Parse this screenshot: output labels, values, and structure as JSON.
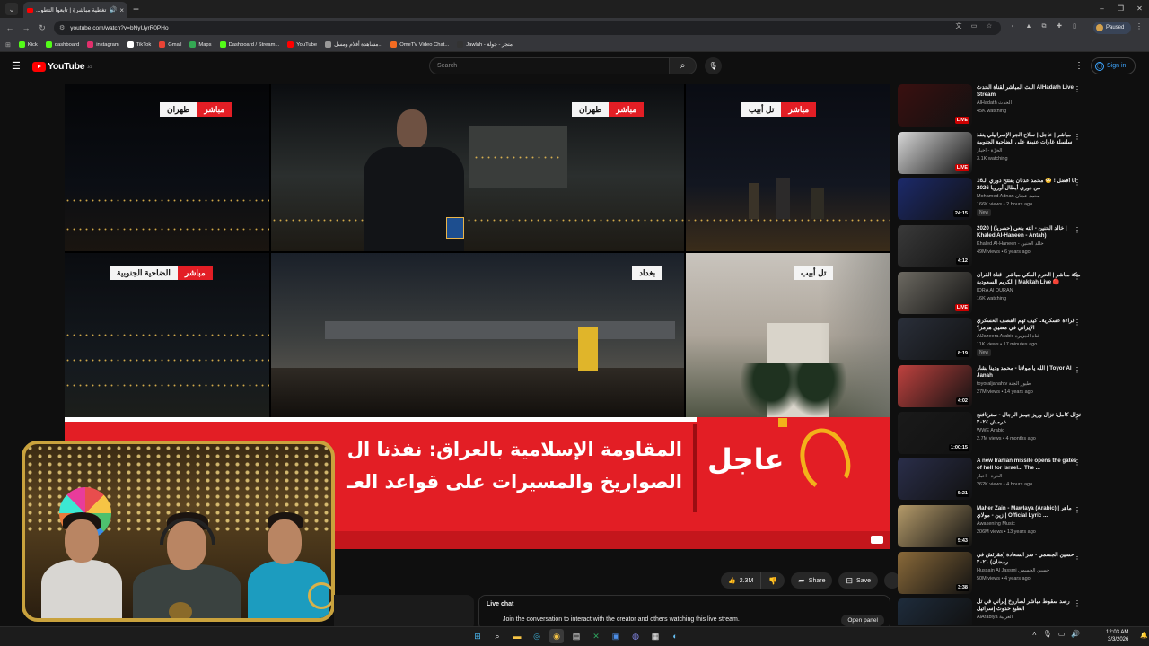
{
  "browser": {
    "tab_title": "تغطية مباشرة | تابعوا التطو...",
    "url": "youtube.com/watch?v=bNyUyrR0PHo",
    "profile_status": "Paused",
    "bookmarks": [
      {
        "label": "Kick",
        "color": "#53fc18"
      },
      {
        "label": "dashboard",
        "color": "#53fc18"
      },
      {
        "label": "instagram",
        "color": "#e1306c"
      },
      {
        "label": "TikTok",
        "color": "#ffffff"
      },
      {
        "label": "Gmail",
        "color": "#ea4335"
      },
      {
        "label": "Maps",
        "color": "#34a853"
      },
      {
        "label": "Dashboard / Stream...",
        "color": "#53fc18"
      },
      {
        "label": "YouTube",
        "color": "#ff0000"
      },
      {
        "label": "مشاهدة أفلام ومسل...",
        "color": "#999999"
      },
      {
        "label": "OmeTV Video Chat...",
        "color": "#f36b21"
      },
      {
        "label": "Jawlah - متجر - جولة",
        "color": "#333333"
      }
    ]
  },
  "youtube": {
    "logo_text": "YouTube",
    "country_code": "JO",
    "search_placeholder": "Search",
    "signin_label": "Sign in"
  },
  "video": {
    "locations": {
      "tehran1": {
        "live": "مباشر",
        "city": "طهران"
      },
      "tehran2": {
        "live": "مباشر",
        "city": "طهران"
      },
      "telaviv1": {
        "live": "مباشر",
        "city": "تل أبيب"
      },
      "dahiyeh": {
        "live": "مباشر",
        "city": "الضاحية الجنوبية"
      },
      "baghdad": {
        "city": "بغداد"
      },
      "telaviv2": {
        "city": "تل أبيب"
      }
    },
    "breaking_label": "عاجل",
    "headline_line1": "المقاومة الإسلامية بالعراق: نفذنا ال",
    "headline_line2": "الصواريخ والمسيرات على قواعد العـ"
  },
  "actions": {
    "likes": "2.3M",
    "share": "Share",
    "save": "Save"
  },
  "live_chat": {
    "title": "Live chat",
    "prompt": "Join the conversation to interact with the creator and others watching this live stream.",
    "open_panel": "Open panel"
  },
  "recommendations": [
    {
      "title": "البث المباشر لقناة الحدث AlHadath Live Stream",
      "channel": "AlHadath الحدث",
      "meta": "45K watching",
      "badge": "LIVE",
      "thumb": "#3a1010"
    },
    {
      "title": "مباشر | عاجل | سلاح الجو الإسرائيلي ينفذ سلسلة غارات عنيفة على الضاحية الجنوبية",
      "channel": "الحرّة - أخبار",
      "meta": "3.1K watching",
      "badge": "LIVE",
      "thumb": "#d8d8d8"
    },
    {
      "title": "أنا أفضل ! 😳 محمد عدنان يفتتح دوري الـ16 من دوري أبطال أوروبا 2026",
      "channel": "Mohamed Adnan محمد عدنان",
      "meta": "166K views • 2 hours ago",
      "badge": "24:15",
      "new": "New",
      "thumb": "#1c2a6b"
    },
    {
      "title": "خالد الحنين - انته بنعي (حصرياً) | 2020 | Khaled Al-Haneen - Antah)",
      "channel": "Khaled Al-Haneen - خالد الحنين",
      "meta": "49M views • 6 years ago",
      "badge": "4:12",
      "thumb": "#3a3a3a"
    },
    {
      "title": "مكة مباشر | الحرم المكي مباشر | قناة القرآن الكريم السعودية | Makkah Live 🔴",
      "channel": "IQRA Al QURAN",
      "meta": "16K watching",
      "badge": "LIVE",
      "thumb": "#6d6a62"
    },
    {
      "title": "قراءة عسكرية.. كيف تهم القصف العسكري الإيراني في مضيق هرمز؟",
      "channel": "AlJazeera Arabic قناة الجزيرة",
      "meta": "11K views • 17 minutes ago",
      "badge": "8:19",
      "new": "New",
      "thumb": "#2a2f3a"
    },
    {
      "title": "الله يا مولانا - محمد ودينا بشار | Toyor Al Janah",
      "channel": "toyoraljanahtv طيور الجنة",
      "meta": "27M views • 14 years ago",
      "badge": "4:02",
      "thumb": "#c0423f"
    },
    {
      "title": "تزلل كامل: تزال وريز جيمز الرجال - سترتافنج عرمش ٢٠٢٤",
      "channel": "WWE Arabic",
      "meta": "2.7M views • 4 months ago",
      "badge": "1:00:15",
      "thumb": "#1a1a1a"
    },
    {
      "title": "A new Iranian missile opens the gates of hell for Israel... The ...",
      "channel": "الحرة - أخبار",
      "meta": "262K views • 4 hours ago",
      "badge": "5:21",
      "thumb": "#2a2e4a"
    },
    {
      "title": "Maher Zain - Mawlaya (Arabic) | ماهر زين - مولاي | Official Lyric ...",
      "channel": "Awakening Music",
      "meta": "206M views • 13 years ago",
      "badge": "5:43",
      "thumb": "#b59b6a"
    },
    {
      "title": "حسين الجسمي - سر السعادة (مقرئش في رمضان) ٢٠٢١",
      "channel": "Hussain Al Jassmi حسين الجسمي",
      "meta": "50M views • 4 years ago",
      "badge": "3:38",
      "thumb": "#8a6a3a"
    },
    {
      "title": "رصد سقوط مباشر لصاروخ إيراني في تل الطبع حدوث إسرائيل",
      "channel": "AlArabiya العربية",
      "meta": "",
      "badge": "",
      "thumb": "#1e2c3c"
    }
  ],
  "taskbar": {
    "time": "12:03 AM",
    "date": "3/3/2026"
  }
}
